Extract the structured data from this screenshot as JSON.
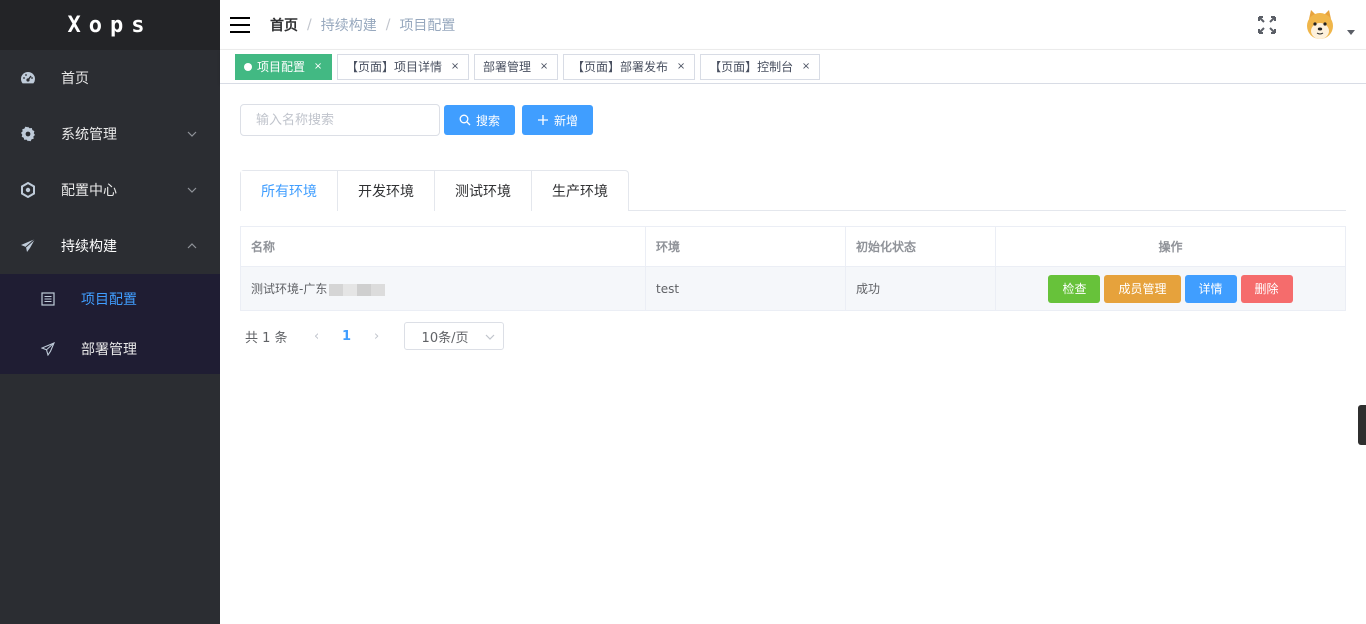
{
  "app": {
    "logo": "Xops"
  },
  "sidebar": {
    "items": [
      {
        "label": "首页",
        "icon": "dashboard-icon"
      },
      {
        "label": "系统管理",
        "icon": "gear-icon"
      },
      {
        "label": "配置中心",
        "icon": "hexagon-icon"
      },
      {
        "label": "持续构建",
        "icon": "send-icon"
      }
    ],
    "subitems": [
      {
        "label": "项目配置",
        "icon": "list-icon",
        "active": true
      },
      {
        "label": "部署管理",
        "icon": "send-outline-icon"
      }
    ]
  },
  "header": {
    "breadcrumb": [
      "首页",
      "持续构建",
      "项目配置"
    ],
    "separator": "/"
  },
  "tags": [
    {
      "label": "项目配置",
      "active": true
    },
    {
      "label": "【页面】项目详情"
    },
    {
      "label": "部署管理"
    },
    {
      "label": "【页面】部署发布"
    },
    {
      "label": "【页面】控制台"
    }
  ],
  "tag_close": "×",
  "toolbar": {
    "search_placeholder": "输入名称搜索",
    "search_label": "搜索",
    "add_label": "新增"
  },
  "tabs": [
    "所有环境",
    "开发环境",
    "测试环境",
    "生产环境"
  ],
  "table": {
    "headers": [
      "名称",
      "环境",
      "初始化状态",
      "操作"
    ],
    "rows": [
      {
        "name": "测试环境-广东",
        "env": "test",
        "status": "成功"
      }
    ],
    "actions": [
      "检查",
      "成员管理",
      "详情",
      "删除"
    ]
  },
  "pagination": {
    "total": "共 1 条",
    "prev": "‹",
    "current": "1",
    "next": "›",
    "page_size": "10条/页"
  },
  "colors": {
    "primary": "#409eff",
    "success": "#67c23a",
    "warning": "#e6a23c",
    "danger": "#f56c6c",
    "tag_active": "#42b983",
    "sidebar_bg": "#2b2d32"
  }
}
